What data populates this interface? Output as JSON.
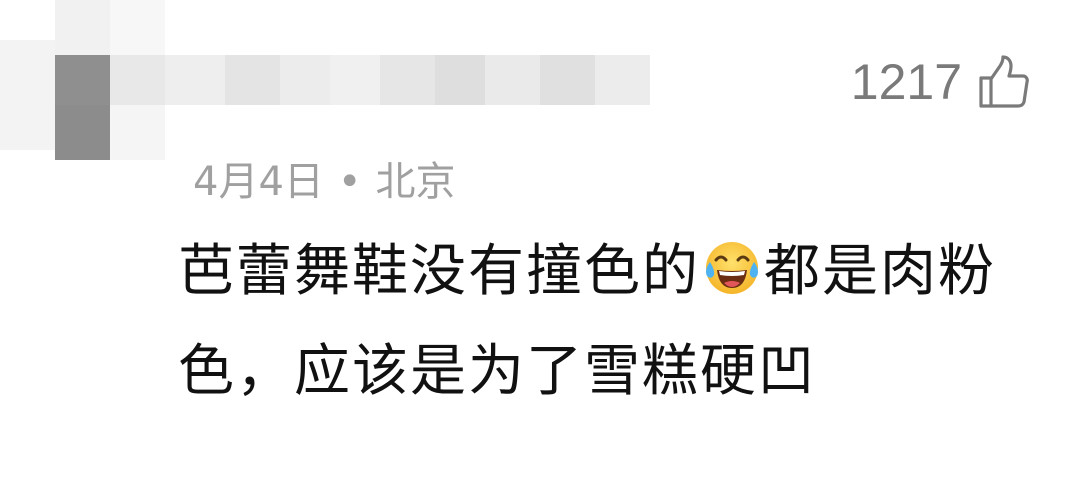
{
  "comment": {
    "likes": "1217",
    "date": "4月4日",
    "separator": "•",
    "location": "北京",
    "text_part1": "芭蕾舞鞋没有撞色的",
    "emoji": "face-with-tears-of-joy",
    "text_part2": "都是肉粉色，应该是为了雪糕硬凹",
    "colors": {
      "text": "#111111",
      "meta": "#a0a0a0",
      "likes": "#7a7a7a"
    }
  },
  "icons": {
    "like": "thumbs-up-icon",
    "emoji": "laughing-tears-emoji-icon"
  }
}
